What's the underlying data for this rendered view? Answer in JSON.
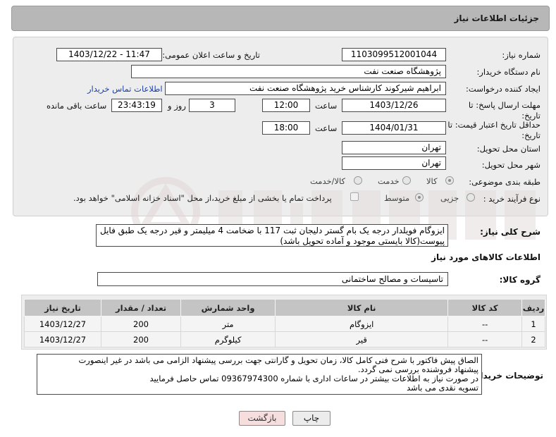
{
  "header": {
    "title": "جزئیات اطلاعات نیاز"
  },
  "fields": {
    "need_number_label": "شماره نیاز:",
    "need_number": "1103099512001044",
    "announce_label": "تاریخ و ساعت اعلان عمومی:",
    "announce_value": "1403/12/22 - 11:47",
    "buyer_org_label": "نام دستگاه خریدار:",
    "buyer_org": "پژوهشگاه صنعت نفت",
    "requester_label": "ایجاد کننده درخواست:",
    "requester": "ابراهیم شیرکوند کارشناس خرید پژوهشگاه صنعت نفت",
    "contact_link": "اطلاعات تماس خریدار",
    "reply_deadline_label": "مهلت ارسال پاسخ: تا تاریخ:",
    "reply_date": "1403/12/26",
    "time_label": "ساعت",
    "reply_time": "12:00",
    "days_value": "3",
    "days_label": "روز و",
    "remaining_time": "23:43:19",
    "remaining_label": "ساعت باقی مانده",
    "price_validity_label": "حداقل تاریخ اعتبار قیمت: تا تاریخ:",
    "price_date": "1404/01/31",
    "price_time": "18:00",
    "province_label": "استان محل تحویل:",
    "province": "تهران",
    "city_label": "شهر محل تحویل:",
    "city": "تهران",
    "category_label": "طبقه بندی موضوعی:",
    "category_options": [
      "کالا",
      "خدمت",
      "کالا/خدمت"
    ],
    "purchase_type_label": "نوع فرآیند خرید :",
    "purchase_options": [
      "جزیی",
      "متوسط"
    ],
    "payment_note": "پرداخت تمام یا بخشی از مبلغ خرید،از محل \"اسناد خزانه اسلامی\" خواهد بود."
  },
  "description": {
    "label": "شرح کلی نیاز:",
    "text": "ایزوگام فویلدار درجه یک بام گستر دلیجان ثبت 117 با ضخامت 4 میلیمتر و قیر درجه یک طبق فایل پیوست(کالا بایستی موجود و آماده تحویل باشد)"
  },
  "goods": {
    "section_title": "اطلاعات کالاهای مورد نیاز",
    "group_label": "گروه کالا:",
    "group_value": "تاسیسات و مصالح ساختمانی",
    "columns": [
      "ردیف",
      "کد کالا",
      "نام کالا",
      "واحد شمارش",
      "تعداد / مقدار",
      "تاریخ نیاز"
    ],
    "rows": [
      {
        "row": "1",
        "code": "--",
        "name": "ایزوگام",
        "unit": "متر",
        "qty": "200",
        "date": "1403/12/27"
      },
      {
        "row": "2",
        "code": "--",
        "name": "قیر",
        "unit": "کیلوگرم",
        "qty": "200",
        "date": "1403/12/27"
      }
    ]
  },
  "notes": {
    "label": "توضیحات خریدار:",
    "lines": [
      "الصاق پیش فاکتور با شرح فنی کامل کالا، زمان تحویل و گارانتی جهت بررسی پیشنهاد الزامی می باشد در غیر اینصورت",
      "پیشنهاد فروشنده بررسی نمی گردد.",
      "در صورت نیاز به اطلاعات بیشتر در ساعات اداری با شماره 09367974300 تماس حاصل فرمایید",
      "تسویه نقدی می باشد"
    ]
  },
  "buttons": {
    "print": "چاپ",
    "back": "بازگشت"
  },
  "colors": {
    "header_bg": "#b7b7b7",
    "panel_bg": "#ededed",
    "link": "#1a3fa8",
    "back_button": "#f6dede"
  }
}
